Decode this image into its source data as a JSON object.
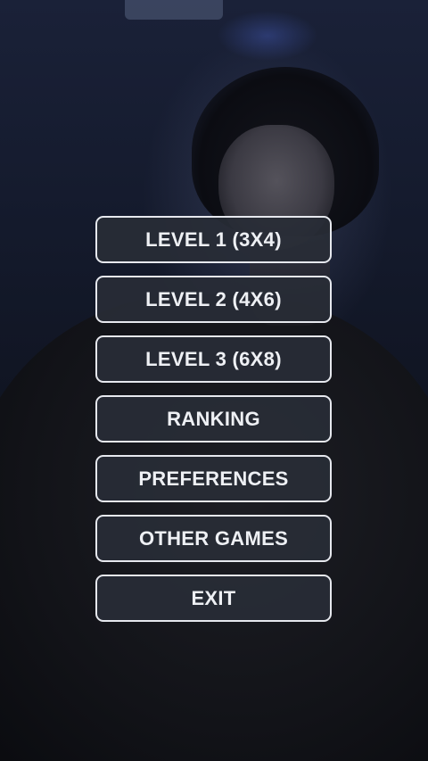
{
  "menu": {
    "buttons": [
      {
        "id": "level-1",
        "label": "LEVEL 1 (3X4)"
      },
      {
        "id": "level-2",
        "label": "LEVEL 2 (4X6)"
      },
      {
        "id": "level-3",
        "label": "LEVEL 3 (6X8)"
      },
      {
        "id": "ranking",
        "label": "RANKING"
      },
      {
        "id": "preferences",
        "label": "PREFERENCES"
      },
      {
        "id": "other-games",
        "label": "OTHER GAMES"
      },
      {
        "id": "exit",
        "label": "EXIT"
      }
    ]
  },
  "colors": {
    "button_background": "#282c36",
    "button_border": "#e6e8ee",
    "button_text": "#eef0f4",
    "backdrop": "#141a2c"
  }
}
